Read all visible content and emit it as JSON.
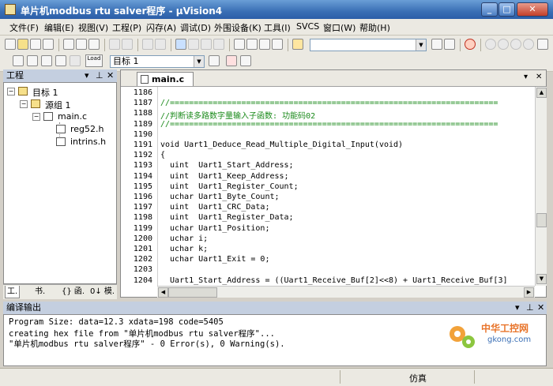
{
  "window": {
    "title": "单片机modbus rtu salver程序 - µVision4"
  },
  "menu": [
    "文件(F)",
    "编辑(E)",
    "视图(V)",
    "工程(P)",
    "闪存(A)",
    "调试(D)",
    "外围设备(K)",
    "工具(I)",
    "SVCS",
    "窗口(W)",
    "帮助(H)"
  ],
  "toolbar2": {
    "load_label": "Load",
    "target_select": "目标 1"
  },
  "project_panel": {
    "title": "工程",
    "tree": {
      "target": "目标 1",
      "group": "源组 1",
      "file": "main.c",
      "includes": [
        "reg52.h",
        "intrins.h"
      ]
    },
    "tabs": [
      "工.",
      "书.",
      "{} 函.",
      "0↓ 模."
    ]
  },
  "editor": {
    "tab": "main.c",
    "line_numbers": [
      "1186",
      "1187",
      "1188",
      "1189",
      "1190",
      "1191",
      "1192",
      "1193",
      "1194",
      "1195",
      "1196",
      "1197",
      "1198",
      "1199",
      "1200",
      "1201",
      "1202",
      "1203",
      "1204"
    ],
    "lines": [
      "",
      "//=====================================================================",
      "//判断读多路数字量输入子函数: 功能码02",
      "//=====================================================================",
      "",
      "void Uart1_Deduce_Read_Multiple_Digital_Input(void)",
      "{",
      "  uint  Uart1_Start_Address;",
      "  uint  Uart1_Keep_Address;",
      "  uint  Uart1_Register_Count;",
      "  uchar Uart1_Byte_Count;",
      "  uint  Uart1_CRC_Data;",
      "  uint  Uart1_Register_Data;",
      "  uchar Uart1_Position;",
      "  uchar i;",
      "  uchar k;",
      "  uchar Uart1_Exit = 0;",
      "",
      "  Uart1_Start_Address = ((Uart1_Receive_Buf[2]<<8) + Uart1_Receive_Buf[3]"
    ]
  },
  "output_panel": {
    "title": "编译输出",
    "lines": [
      "Program Size: data=12.3 xdata=198 code=5405",
      "creating hex file from \"单片机modbus rtu salver程序\"...",
      "\"单片机modbus rtu salver程序\" - 0 Error(s), 0 Warning(s)."
    ]
  },
  "statusbar": {
    "mode": "仿真"
  },
  "watermark": {
    "cn": "中华工控网",
    "url": "gkong.com"
  },
  "colors": {
    "comment": "#1a8a1a",
    "number": "#a000a0",
    "titlebar": "#3a6fb5"
  }
}
